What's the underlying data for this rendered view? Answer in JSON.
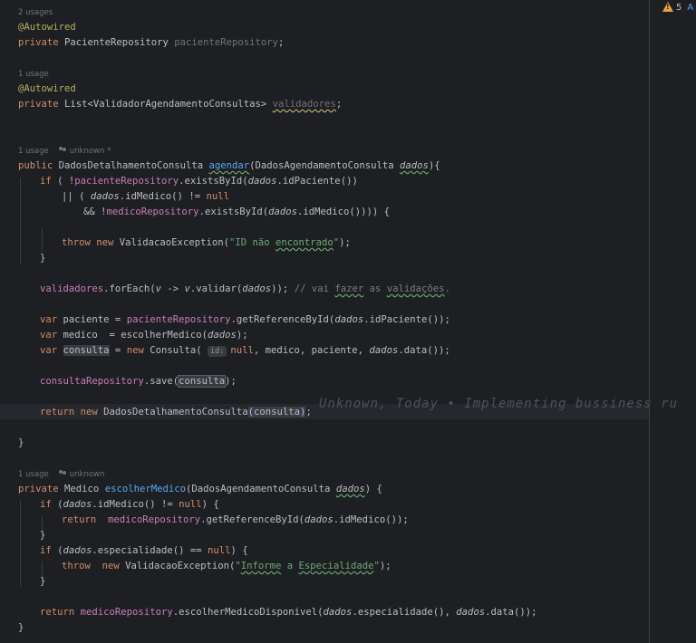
{
  "status": {
    "warning_count": "5",
    "extra_letter": "A"
  },
  "hints": {
    "h1": "2 usages",
    "h2": "1 usage",
    "h3": "1 usage",
    "h3_author": "unknown *",
    "h4": "1 usage",
    "h4_author": "unknown"
  },
  "blame": "Unknown, Today • Implementing bussiness ru",
  "code": {
    "l1a": "@Autowired",
    "l1b_kw": "private ",
    "l1b_type": "PacienteRepository ",
    "l1b_name": "pacienteRepository",
    "l1b_end": ";",
    "l2a": "@Autowired",
    "l2b_kw": "private ",
    "l2b_type": "List<ValidadorAgendamentoConsultas> ",
    "l2b_name": "validadores",
    "l2b_end": ";",
    "m1_kw": "public ",
    "m1_type": "DadosDetalhamentoConsulta ",
    "m1_name": "agendar",
    "m1_p1": "(DadosAgendamentoConsulta ",
    "m1_p2": "dados",
    "m1_p3": "){",
    "if1_kw": "if",
    "if1_a": " ( !",
    "if1_b": "pacienteRepository",
    "if1_c": ".existsById(",
    "if1_d": "dados",
    "if1_e": ".idPaciente())",
    "or_a": "|| ( ",
    "or_b": "dados",
    "or_c": ".idMedico() != ",
    "or_d": "null",
    "and_a": "&& !",
    "and_b": "medicoRepository",
    "and_c": ".existsById(",
    "and_d": "dados",
    "and_e": ".idMedico()))) {",
    "thr_kw": "throw new ",
    "thr_cls": "ValidacaoException(",
    "thr_str1": "\"ID não ",
    "thr_str2": "encontrado",
    "thr_str3": "\"",
    "thr_end": ");",
    "close1": "}",
    "val_a": "validadores",
    "val_b": ".forEach(",
    "val_c": "v",
    "val_d": " -> ",
    "val_e": "v",
    "val_f": ".validar(",
    "val_g": "dados",
    "val_h": ")); ",
    "val_cmt1": "// vai ",
    "val_cmt2": "fazer",
    "val_cmt3": " as ",
    "val_cmt4": "validações",
    "val_cmt5": ".",
    "v1_kw": "var ",
    "v1_a": "paciente = ",
    "v1_b": "pacienteRepository",
    "v1_c": ".getReferenceById(",
    "v1_d": "dados",
    "v1_e": ".idPaciente());",
    "v2_kw": "var ",
    "v2_a": "medico  = escolherMedico(",
    "v2_d": "dados",
    "v2_e": ");",
    "v3_kw": "var ",
    "v3_a": "consulta",
    "v3_b": " = ",
    "v3_kw2": "new ",
    "v3_c": "Consulta",
    "v3_d": "( ",
    "v3_inlay": "id:",
    "v3_kw3": "null",
    "v3_e": ", medico, paciente, ",
    "v3_f": "dados",
    "v3_g": ".data());",
    "s_a": "consultaRepository",
    "s_b": ".save(",
    "s_c": "consulta",
    "s_d": ");",
    "r_kw": "return new ",
    "r_a": "DadosDetalhamentoConsulta",
    "r_b": "(",
    "r_c": "consulta",
    "r_d": ")",
    "r_e": ";",
    "close2": "}",
    "m2_kw": "private ",
    "m2_type": "Medico ",
    "m2_name": "escolherMedico",
    "m2_p1": "(DadosAgendamentoConsulta ",
    "m2_p2": "dados",
    "m2_p3": ") {",
    "if2_kw": "if",
    "if2_a": " (",
    "if2_b": "dados",
    "if2_c": ".idMedico() != ",
    "if2_d": "null",
    "if2_e": ") {",
    "ret2_kw": "return ",
    "ret2_a": " medicoRepository",
    "ret2_b": ".getReferenceById(",
    "ret2_c": "dados",
    "ret2_d": ".idMedico());",
    "close3": "}",
    "if3_kw": "if",
    "if3_a": " (",
    "if3_b": "dados",
    "if3_c": ".especialidade() == ",
    "if3_d": "null",
    "if3_e": ") {",
    "thr2_kw": "throw  new ",
    "thr2_cls": "ValidacaoException(",
    "thr2_s1": "\"",
    "thr2_s2": "Informe",
    "thr2_s3": " a ",
    "thr2_s4": "Especialidade",
    "thr2_s5": "\"",
    "thr2_end": ");",
    "close4": "}",
    "ret3_kw": "return ",
    "ret3_a": "medicoRepository",
    "ret3_b": ".escolherMedicoDisponivel(",
    "ret3_c": "dados",
    "ret3_d": ".especialidade(), ",
    "ret3_e": "dados",
    "ret3_f": ".data());",
    "close5": "}"
  }
}
